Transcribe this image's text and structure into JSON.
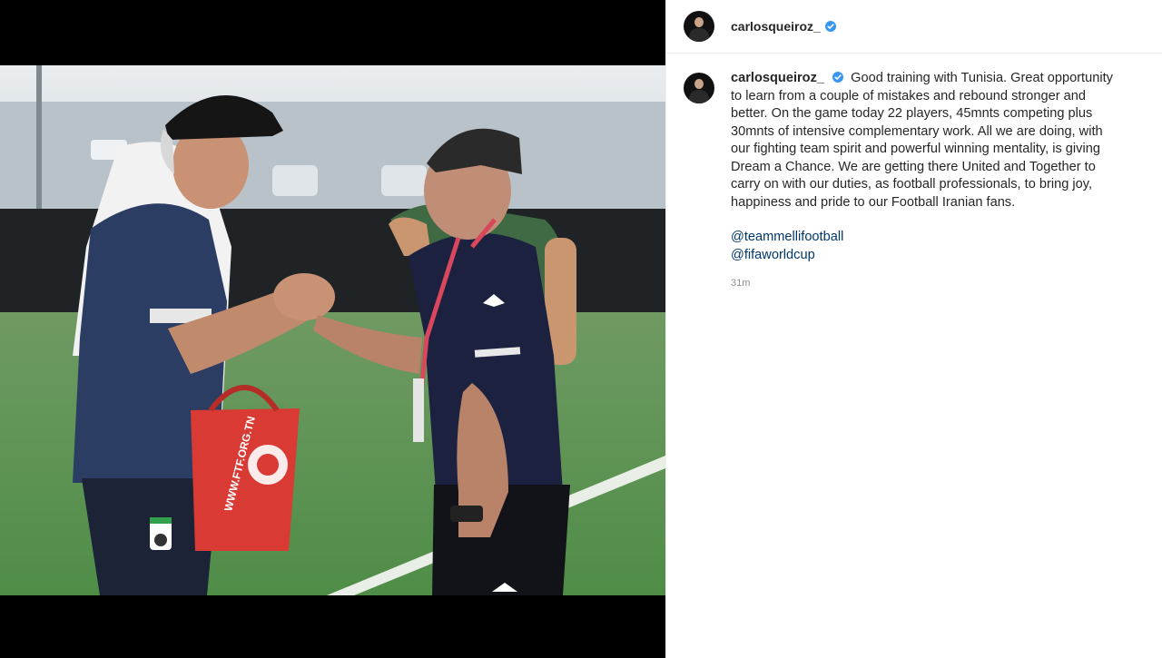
{
  "post": {
    "username": "carlosqueiroz_",
    "caption": "Good training with Tunisia. Great opportunity to learn from a couple of mistakes and rebound stronger and better. On the game today 22 players, 45mnts competing plus 30mnts of intensive complementary work. All we are doing, with our fighting team spirit and powerful winning mentality, is giving Dream a Chance. We are getting there United and Together to carry on with our duties, as football professionals, to bring joy, happiness and pride to our Football Iranian fans.",
    "mentions": [
      "@teammellifootball",
      "@fifaworldcup"
    ],
    "timestamp": "31m"
  },
  "photo": {
    "bag_text": "WWW.FTF.ORG.TN"
  },
  "colors": {
    "verified": "#3897f0",
    "link": "#00376b",
    "muted": "#8e8e8e"
  }
}
